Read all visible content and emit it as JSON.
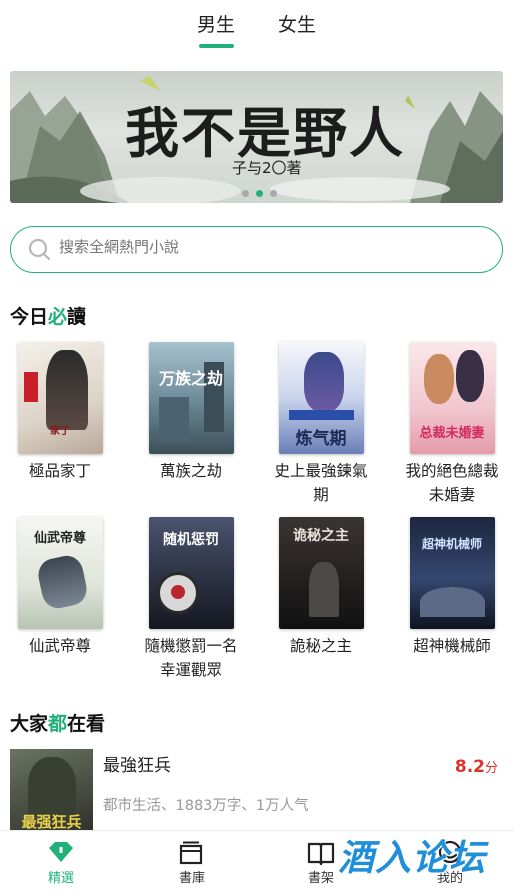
{
  "top_tabs": [
    {
      "label": "男生",
      "active": true
    },
    {
      "label": "女生",
      "active": false
    }
  ],
  "banner": {
    "title": "我不是野人",
    "author": "子与2〇著",
    "dots": 3,
    "active_dot": 1
  },
  "search": {
    "placeholder": "搜索全網熱門小說"
  },
  "section_today": {
    "prefix": "今日",
    "highlight": "必",
    "suffix": "讀"
  },
  "books": [
    {
      "name": "極品家丁",
      "cover_text": "家丁"
    },
    {
      "name": "萬族之劫",
      "cover_text": "万族之劫"
    },
    {
      "name": "史上最強鍊氣期",
      "cover_text": "炼气期"
    },
    {
      "name": "我的絕色總裁未婚妻",
      "cover_text": "总裁未婚妻"
    },
    {
      "name": "仙武帝尊",
      "cover_text": "仙武帝尊"
    },
    {
      "name": "隨機懲罰一名幸運觀眾",
      "cover_text": "随机惩罚"
    },
    {
      "name": "詭秘之主",
      "cover_text": "诡秘之主"
    },
    {
      "name": "超神機械師",
      "cover_text": "超神机械师"
    }
  ],
  "section_popular": {
    "prefix": "大家",
    "highlight": "都",
    "suffix": "在看"
  },
  "list_item": {
    "title": "最強狂兵",
    "meta": "都市生活、1883万字、1万人气",
    "score": "8.2",
    "score_unit": "分",
    "cover_text": "最强狂兵"
  },
  "bottom_nav": [
    {
      "label": "精選",
      "icon": "diamond-icon",
      "active": true
    },
    {
      "label": "書庫",
      "icon": "library-icon",
      "active": false
    },
    {
      "label": "書架",
      "icon": "bookshelf-icon",
      "active": false
    },
    {
      "label": "我的",
      "icon": "profile-icon",
      "active": false
    }
  ],
  "watermark": "酒入论坛",
  "colors": {
    "accent": "#21b07a",
    "score": "#d9342b",
    "watermark": "#1e8fd8"
  }
}
